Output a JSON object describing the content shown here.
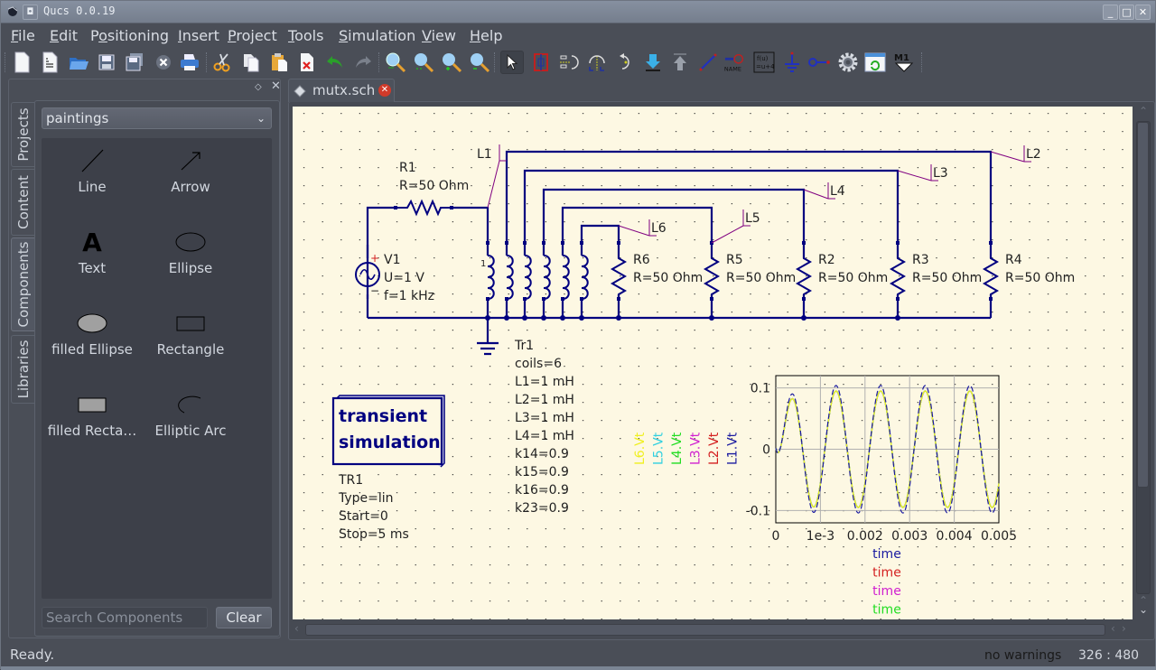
{
  "window": {
    "title": "Qucs 0.0.19",
    "controls": {
      "minimize": "_",
      "maximize": "□",
      "close": "✕"
    }
  },
  "menubar": {
    "items": [
      {
        "label": "File",
        "mnemonic": "F"
      },
      {
        "label": "Edit",
        "mnemonic": "E"
      },
      {
        "label": "Positioning",
        "mnemonic": "o"
      },
      {
        "label": "Insert",
        "mnemonic": "I"
      },
      {
        "label": "Project",
        "mnemonic": "P"
      },
      {
        "label": "Tools",
        "mnemonic": "T"
      },
      {
        "label": "Simulation",
        "mnemonic": "S"
      },
      {
        "label": "View",
        "mnemonic": "V"
      },
      {
        "label": "Help",
        "mnemonic": "H"
      }
    ]
  },
  "toolbar": {
    "buttons": [
      "new-file",
      "new-text",
      "open",
      "save",
      "save-all",
      "close",
      "print",
      "cut",
      "copy",
      "paste",
      "delete",
      "undo",
      "redo",
      "view-all",
      "view-1to1",
      "zoom-in",
      "zoom-out",
      "select",
      "edit-activate",
      "mirror-x",
      "mirror-y",
      "rotate",
      "enter-subcircuit",
      "exit-subcircuit",
      "wire",
      "wire-label",
      "equation",
      "ground",
      "port",
      "simulate",
      "data-display",
      "marker"
    ],
    "equation_label": "f(u)\n=u+4",
    "wirelabel_text": "NAME",
    "marker_text": "M1"
  },
  "dock": {
    "float_icon": "◇",
    "close_icon": "✕",
    "tabs": [
      "Projects",
      "Content",
      "Components",
      "Libraries"
    ],
    "active_tab": "Components",
    "category": "paintings",
    "components": [
      {
        "label": "Line",
        "icon": "line-icon"
      },
      {
        "label": "Arrow",
        "icon": "arrow-icon"
      },
      {
        "label": "Text",
        "icon": "text-icon"
      },
      {
        "label": "Ellipse",
        "icon": "ellipse-icon"
      },
      {
        "label": "filled Ellipse",
        "icon": "filled-ellipse-icon"
      },
      {
        "label": "Rectangle",
        "icon": "rectangle-icon"
      },
      {
        "label": "filled Recta…",
        "icon": "filled-rectangle-icon"
      },
      {
        "label": "Elliptic Arc",
        "icon": "elliptic-arc-icon"
      }
    ],
    "text_glyph": "A",
    "search_placeholder": "Search Components",
    "clear_label": "Clear"
  },
  "document": {
    "tab_name": "mutx.sch",
    "schematic": {
      "R1": {
        "name": "R1",
        "value": "R=50 Ohm"
      },
      "V1": {
        "name": "V1",
        "u": "U=1 V",
        "f": "f=1 kHz",
        "plus": "+",
        "minus": "−"
      },
      "coil_index": "1",
      "labels": [
        "L1",
        "L2",
        "L3",
        "L4",
        "L5",
        "L6"
      ],
      "resistors": [
        {
          "name": "R6",
          "value": "R=50 Ohm"
        },
        {
          "name": "R5",
          "value": "R=50 Ohm"
        },
        {
          "name": "R2",
          "value": "R=50 Ohm"
        },
        {
          "name": "R3",
          "value": "R=50 Ohm"
        },
        {
          "name": "R4",
          "value": "R=50 Ohm"
        }
      ],
      "Tr1": [
        "Tr1",
        "coils=6",
        "L1=1 mH",
        "L2=1 mH",
        "L3=1 mH",
        "L4=1 mH",
        "k14=0.9",
        "k15=0.9",
        "k16=0.9",
        "k23=0.9"
      ],
      "sim_block": {
        "line1": "transient",
        "line2": "simulation"
      },
      "TR1": [
        "TR1",
        "Type=lin",
        "Start=0",
        "Stop=5 ms"
      ]
    }
  },
  "chart_data": {
    "type": "line",
    "title": "",
    "xlabel": "time",
    "x_axis_labels": [
      {
        "text": "time",
        "color": "#1a1aa0"
      },
      {
        "text": "time",
        "color": "#d42020"
      },
      {
        "text": "time",
        "color": "#d020d0"
      },
      {
        "text": "time",
        "color": "#22dd22"
      }
    ],
    "legend_placement": "left (rotated)",
    "series": [
      {
        "name": "L6.Vt",
        "color": "#f0f020"
      },
      {
        "name": "L5.Vt",
        "color": "#30d0e0"
      },
      {
        "name": "L4.Vt",
        "color": "#22dd22"
      },
      {
        "name": "L3.Vt",
        "color": "#d020d0"
      },
      {
        "name": "L2.Vt",
        "color": "#d42020"
      },
      {
        "name": "L1.Vt",
        "color": "#1a1aa0"
      }
    ],
    "xlim": [
      0,
      0.005
    ],
    "ylim": [
      -0.12,
      0.12
    ],
    "xticks": [
      0,
      0.001,
      0.002,
      0.003,
      0.004,
      0.005
    ],
    "xtick_labels": [
      "0",
      "1e-3",
      "0.002",
      "0.003",
      "0.004",
      "0.005"
    ],
    "yticks": [
      -0.1,
      0,
      0.1
    ],
    "ytick_labels": [
      "-0.1",
      "0",
      "0.1"
    ],
    "grid": true,
    "waveform": {
      "frequency_hz": 1000,
      "peaks_L1": [
        {
          "t": 0.00015,
          "v": 0.073
        },
        {
          "t": 0.0006,
          "v": -0.104
        },
        {
          "t": 0.0011,
          "v": 0.103
        },
        {
          "t": 0.0016,
          "v": -0.104
        },
        {
          "t": 0.0021,
          "v": 0.103
        },
        {
          "t": 0.0026,
          "v": -0.104
        },
        {
          "t": 0.0031,
          "v": 0.103
        },
        {
          "t": 0.0036,
          "v": -0.104
        },
        {
          "t": 0.0041,
          "v": 0.103
        },
        {
          "t": 0.0046,
          "v": -0.104
        }
      ],
      "end_value": 0.083,
      "other_series_amplitude": 0.095
    }
  },
  "statusbar": {
    "message": "Ready.",
    "warnings": "no warnings",
    "coords": "326 : 480"
  }
}
